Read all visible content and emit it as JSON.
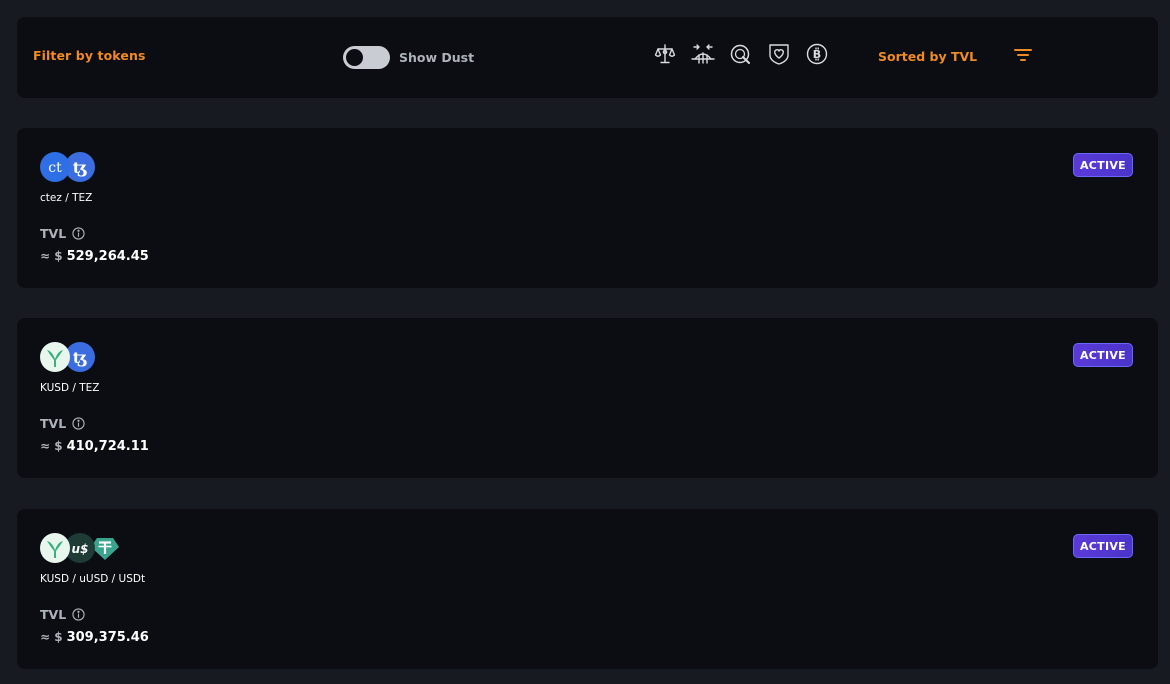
{
  "filter_bar": {
    "filter_label": "Filter by tokens",
    "dust_toggle_label": "Show Dust",
    "dust_toggle_on": false,
    "category_icons": [
      "scale-icon",
      "bridge-icon",
      "shield-q-icon",
      "heart-shield-icon",
      "bitcoin-icon"
    ],
    "sort_label": "Sorted by TVL",
    "accent_color": "#f08a24"
  },
  "pools": [
    {
      "tokens": [
        "ctez-token-icon",
        "tezos-token-icon"
      ],
      "name": "ctez / TEZ",
      "tvl_label": "TVL",
      "approx": "≈ $",
      "tvl_value": "529,264.45",
      "status": "ACTIVE"
    },
    {
      "tokens": [
        "kusd-token-icon",
        "tezos-token-icon"
      ],
      "name": "KUSD / TEZ",
      "tvl_label": "TVL",
      "approx": "≈ $",
      "tvl_value": "410,724.11",
      "status": "ACTIVE"
    },
    {
      "tokens": [
        "kusd-token-icon",
        "uusd-token-icon",
        "usdt-token-icon"
      ],
      "name": "KUSD / uUSD / USDt",
      "tvl_label": "TVL",
      "approx": "≈ $",
      "tvl_value": "309,375.46",
      "status": "ACTIVE"
    }
  ]
}
